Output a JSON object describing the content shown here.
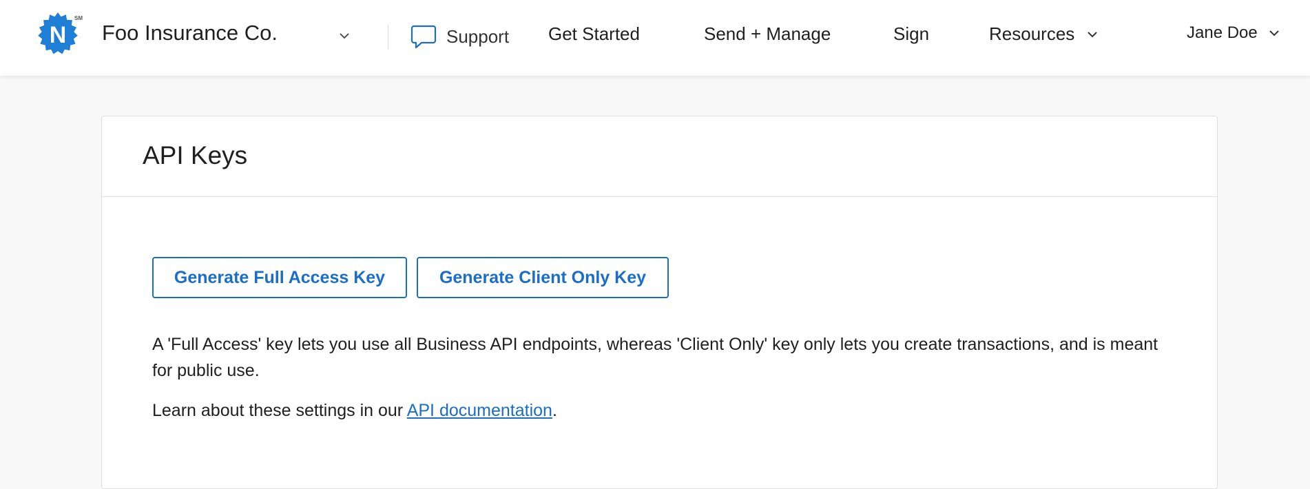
{
  "header": {
    "org_name": "Foo Insurance Co.",
    "logo_letter": "N",
    "logo_mark": "SM",
    "support_label": "Support",
    "nav": {
      "get_started": "Get Started",
      "send_manage": "Send + Manage",
      "sign": "Sign",
      "resources": "Resources"
    },
    "user_name": "Jane Doe"
  },
  "icons": {
    "logo": "seal-logo-icon",
    "org_dropdown": "chevron-down-icon",
    "support": "chat-bubble-icon",
    "resources_dropdown": "chevron-down-icon",
    "user_dropdown": "chevron-down-icon"
  },
  "colors": {
    "accent": "#1a6ec9",
    "logo_blue": "#1f7fd6",
    "text": "#1f1f1f",
    "page_bg": "#f8f8f8"
  },
  "card": {
    "title": "API Keys",
    "buttons": {
      "full_access": "Generate Full Access Key",
      "client_only": "Generate Client Only Key"
    },
    "description": "A 'Full Access' key lets you use all Business API endpoints, whereas 'Client Only' key only lets you create transactions, and is meant for public use.",
    "learn_prefix": "Learn about these settings in our ",
    "learn_link": "API documentation",
    "learn_suffix": "."
  }
}
